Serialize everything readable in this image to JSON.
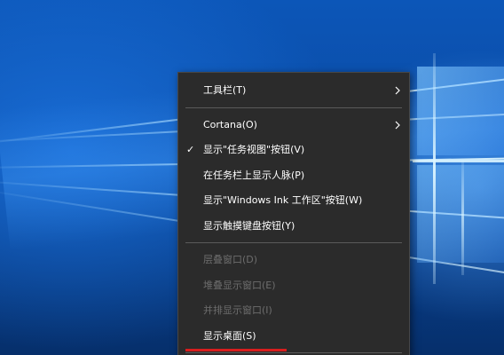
{
  "context_menu": {
    "items": [
      {
        "label": "工具栏(T)",
        "submenu": true
      },
      {
        "label": "Cortana(O)",
        "submenu": true
      },
      {
        "label": "显示\"任务视图\"按钮(V)",
        "checked": true
      },
      {
        "label": "在任务栏上显示人脉(P)"
      },
      {
        "label": "显示\"Windows Ink 工作区\"按钮(W)"
      },
      {
        "label": "显示触摸键盘按钮(Y)"
      },
      {
        "label": "层叠窗口(D)",
        "disabled": true
      },
      {
        "label": "堆叠显示窗口(E)",
        "disabled": true
      },
      {
        "label": "并排显示窗口(I)",
        "disabled": true
      },
      {
        "label": "显示桌面(S)"
      }
    ],
    "check_glyph": "✓",
    "icons": {
      "submenu": "chevron-right-icon",
      "checked": "checkmark-icon"
    }
  },
  "colors": {
    "menu_bg": "#2b2b2b",
    "menu_text": "#ffffff",
    "menu_disabled_text": "#6d6d6d",
    "separator": "#5a5a5a",
    "highlight_bar": "#d81e1e",
    "wallpaper_blue": "#0a4aa2"
  }
}
